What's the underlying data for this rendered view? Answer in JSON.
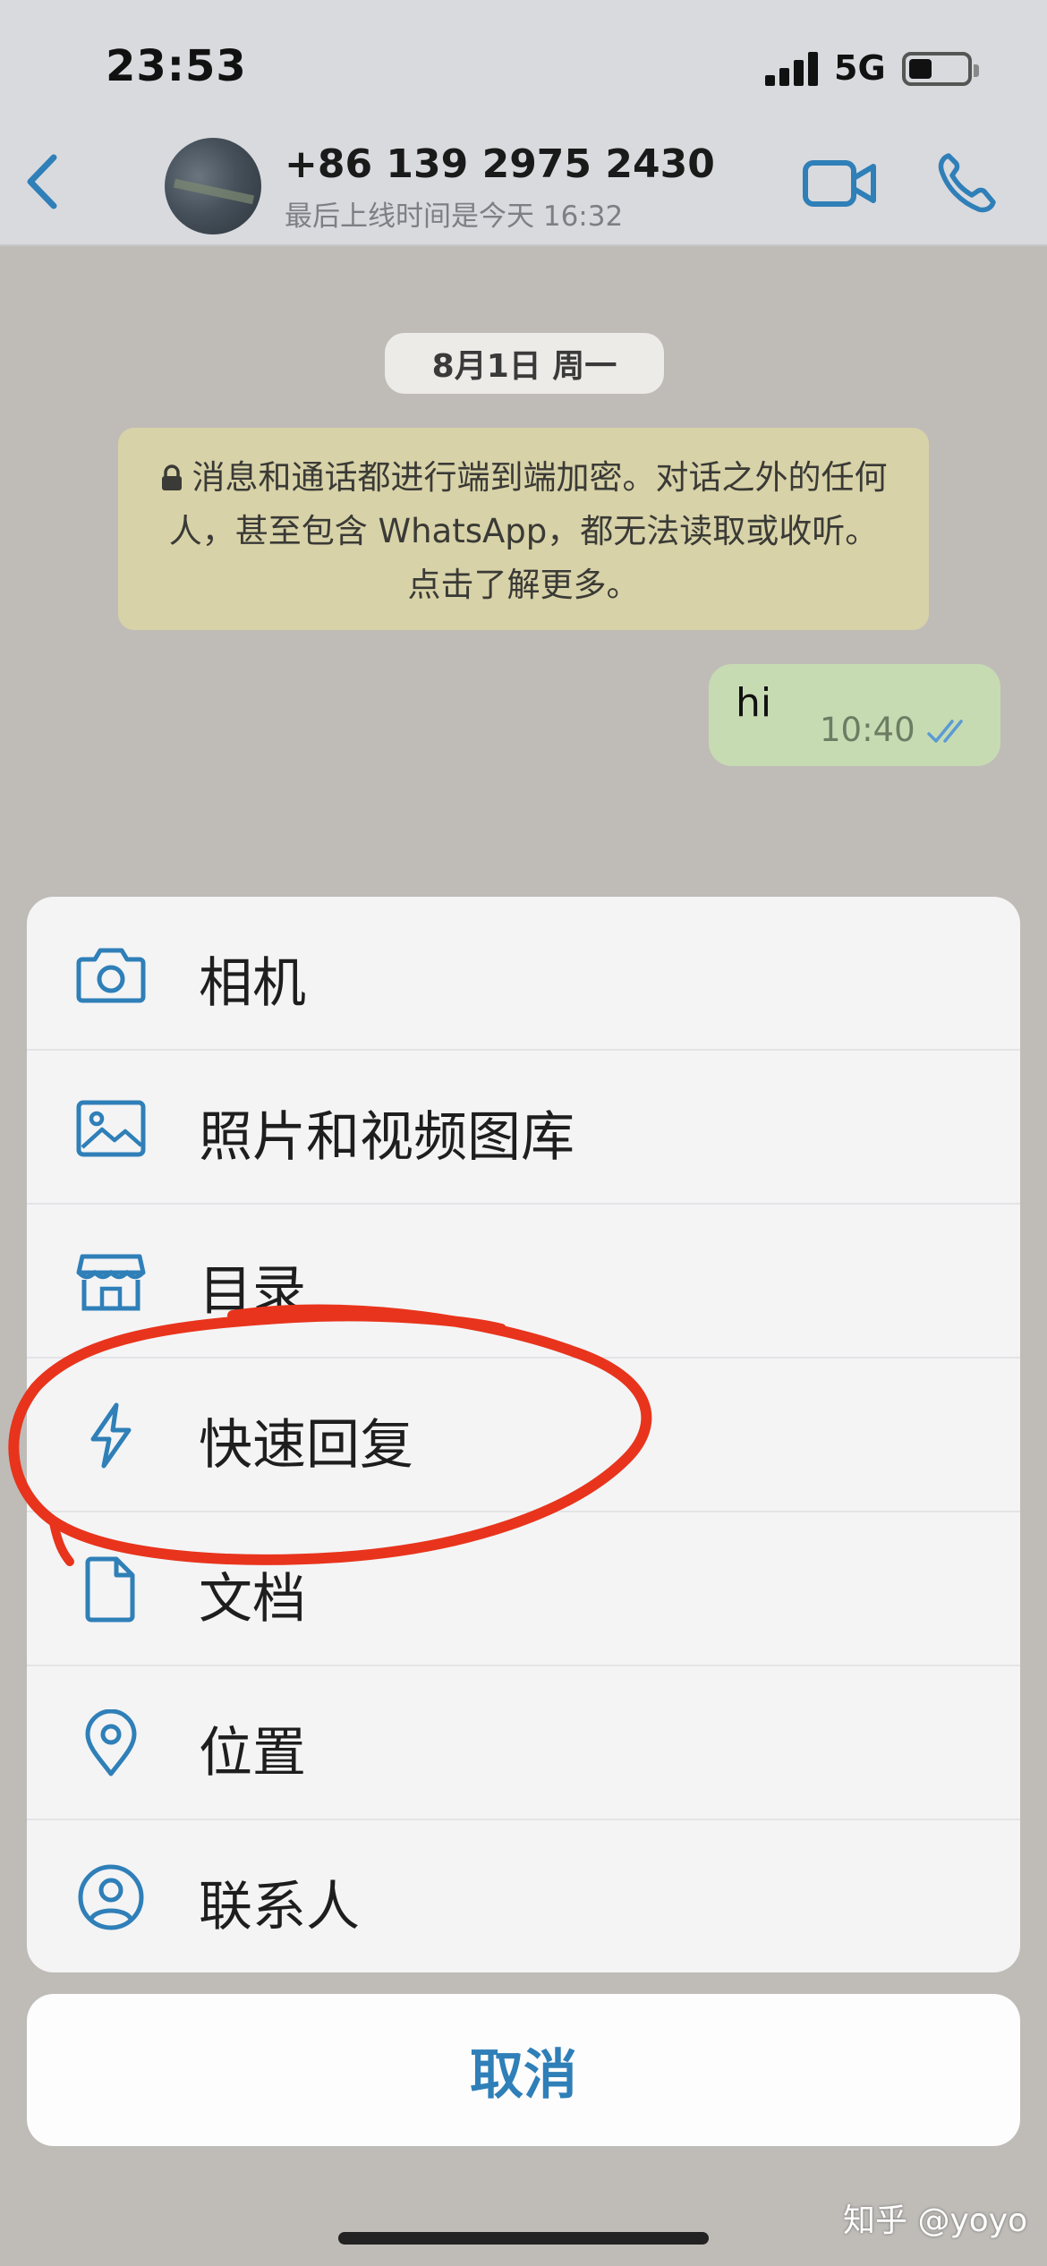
{
  "status_bar": {
    "time": "23:53",
    "network": "5G",
    "battery_level": 0.4
  },
  "header": {
    "contact_name": "+86 139 2975 2430",
    "last_seen": "最后上线时间是今天 16:32",
    "icons": [
      "chevron-left-icon",
      "video-camera-icon",
      "phone-icon"
    ]
  },
  "chat": {
    "date_label": "8月1日 周一",
    "encryption_notice": "消息和通话都进行端到端加密。对话之外的任何人，甚至包含 WhatsApp，都无法读取或收听。点击了解更多。",
    "messages": [
      {
        "text": "hi",
        "time": "10:40",
        "status": "read"
      }
    ]
  },
  "action_sheet": {
    "items": [
      {
        "label": "相机",
        "icon": "camera-icon"
      },
      {
        "label": "照片和视频图库",
        "icon": "photo-library-icon"
      },
      {
        "label": "目录",
        "icon": "storefront-icon"
      },
      {
        "label": "快速回复",
        "icon": "lightning-icon"
      },
      {
        "label": "文档",
        "icon": "document-icon"
      },
      {
        "label": "位置",
        "icon": "location-pin-icon"
      },
      {
        "label": "联系人",
        "icon": "contact-icon"
      }
    ],
    "cancel_label": "取消"
  },
  "watermark": "知乎 @yoyo",
  "colors": {
    "accent": "#2f7fb8",
    "annotation": "#e8341c",
    "outgoing_bubble": "#c7dbb3",
    "notice_bg": "#d8d2a8"
  }
}
